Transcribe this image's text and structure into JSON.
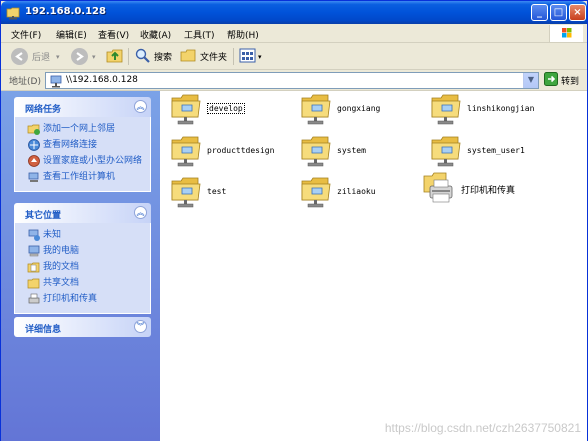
{
  "window": {
    "title": "192.168.0.128",
    "controls": [
      "minimize",
      "maximize",
      "close"
    ]
  },
  "menubar": {
    "items": [
      "文件(F)",
      "编辑(E)",
      "查看(V)",
      "收藏(A)",
      "工具(T)",
      "帮助(H)"
    ]
  },
  "toolbar": {
    "back_label": "后退",
    "search_label": "搜索",
    "folders_label": "文件夹"
  },
  "address": {
    "label": "地址(D)",
    "value": "\\\\192.168.0.128",
    "go_label": "转到"
  },
  "taskpane": {
    "network_tasks": {
      "title": "网络任务",
      "items": [
        "添加一个网上邻居",
        "查看网络连接",
        "设置家庭或小型办公网络",
        "查看工作组计算机"
      ]
    },
    "other_places": {
      "title": "其它位置",
      "items": [
        "未知",
        "我的电脑",
        "我的文档",
        "共享文档",
        "打印机和传真"
      ]
    },
    "details": {
      "title": "详细信息"
    }
  },
  "files": [
    {
      "name": "develop",
      "type": "share",
      "selected": true
    },
    {
      "name": "gongxiang",
      "type": "share",
      "selected": false
    },
    {
      "name": "linshikongjian",
      "type": "share",
      "selected": false
    },
    {
      "name": "producttdesign",
      "type": "share",
      "selected": false
    },
    {
      "name": "system",
      "type": "share",
      "selected": false
    },
    {
      "name": "system_user1",
      "type": "share",
      "selected": false
    },
    {
      "name": "test",
      "type": "share",
      "selected": false
    },
    {
      "name": "ziliaoku",
      "type": "share",
      "selected": false
    },
    {
      "name": "打印机和传真",
      "type": "printers",
      "selected": false
    }
  ],
  "watermark": "https://blog.csdn.net/czh2637750821",
  "colors": {
    "titlebar": "#0152d9",
    "taskpane": "#7ba2e7",
    "link": "#215dc6",
    "folder": "#f3d36b"
  }
}
